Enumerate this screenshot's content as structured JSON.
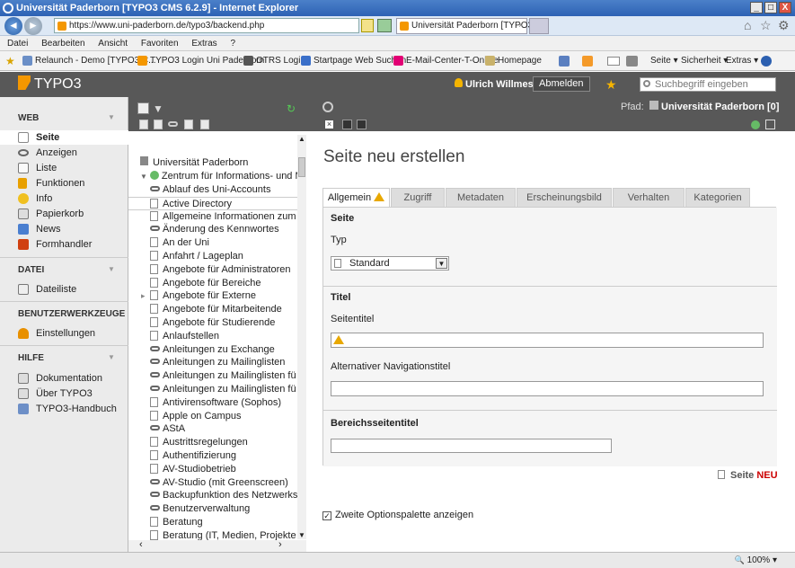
{
  "window": {
    "title": "Universität Paderborn [TYPO3 CMS 6.2.9] - Internet Explorer",
    "min": "_",
    "max": "□",
    "close": "X"
  },
  "browser": {
    "address": "https://www.uni-paderborn.de/typo3/backend.php",
    "tab_active": "Universität Paderborn [TYPO3 ...",
    "tab_close": "×"
  },
  "menu": [
    "Datei",
    "Bearbeiten",
    "Ansicht",
    "Favoriten",
    "Extras",
    "?"
  ],
  "favorites": [
    {
      "label": "Relaunch - Demo [TYPO3 C...",
      "icon": "page-icon",
      "color": "#6b8fc7"
    },
    {
      "label": "TYPO3 Login Uni Paderborn",
      "icon": "typo3-icon",
      "color": "#f49700"
    },
    {
      "label": "OTRS  Login",
      "icon": "otrs-icon",
      "color": "#555555"
    },
    {
      "label": "Startpage Web Suchen",
      "icon": "startpage-icon",
      "color": "#3a6fc9"
    },
    {
      "label": "E-Mail-Center-T-Online",
      "icon": "telekom-icon",
      "color": "#e20074"
    },
    {
      "label": "Homepage",
      "icon": "page-icon",
      "color": "#c9b26b"
    }
  ],
  "ie_commands": [
    "Seite ▾",
    "Sicherheit ▾",
    "Extras ▾"
  ],
  "typo3": {
    "logo": "TYPO3",
    "user": "Ulrich Willmes",
    "logout": "Abmelden",
    "search_placeholder": "Suchbegriff eingeben",
    "path_label": "Pfad:",
    "path_value": "Universität Paderborn [0]"
  },
  "modules": {
    "web": {
      "heading": "WEB",
      "items": [
        "Seite",
        "Anzeigen",
        "Liste",
        "Funktionen",
        "Info",
        "Papierkorb",
        "News",
        "Formhandler"
      ]
    },
    "datei": {
      "heading": "DATEI",
      "items": [
        "Dateiliste"
      ]
    },
    "tools": {
      "heading": "BENUTZERWERKZEUGE",
      "items": [
        "Einstellungen"
      ]
    },
    "hilfe": {
      "heading": "HILFE",
      "items": [
        "Dokumentation",
        "Über TYPO3",
        "TYPO3-Handbuch"
      ]
    }
  },
  "tree": {
    "root": "Universität Paderborn",
    "zim": "Zentrum für Informations- und M",
    "items": [
      {
        "label": "Ablauf des Uni-Accounts",
        "icon": "link"
      },
      {
        "label": "Active Directory",
        "icon": "page"
      },
      {
        "label": "Allgemeine Informationen zum",
        "icon": "page"
      },
      {
        "label": "Änderung des Kennwortes",
        "icon": "link"
      },
      {
        "label": "An der Uni",
        "icon": "page"
      },
      {
        "label": "Anfahrt / Lageplan",
        "icon": "page"
      },
      {
        "label": "Angebote für Administratoren",
        "icon": "page"
      },
      {
        "label": "Angebote für Bereiche",
        "icon": "page"
      },
      {
        "label": "Angebote für Externe",
        "icon": "page"
      },
      {
        "label": "Angebote für Mitarbeitende",
        "icon": "page"
      },
      {
        "label": "Angebote für Studierende",
        "icon": "page"
      },
      {
        "label": "Anlaufstellen",
        "icon": "page"
      },
      {
        "label": "Anleitungen zu Exchange",
        "icon": "link"
      },
      {
        "label": "Anleitungen zu Mailinglisten",
        "icon": "link"
      },
      {
        "label": "Anleitungen zu Mailinglisten fü",
        "icon": "link"
      },
      {
        "label": "Anleitungen zu Mailinglisten fü",
        "icon": "link"
      },
      {
        "label": "Antivirensoftware (Sophos)",
        "icon": "page"
      },
      {
        "label": "Apple on Campus",
        "icon": "page"
      },
      {
        "label": "AStA",
        "icon": "link"
      },
      {
        "label": "Austrittsregelungen",
        "icon": "page"
      },
      {
        "label": "Authentifizierung",
        "icon": "page"
      },
      {
        "label": "AV-Studiobetrieb",
        "icon": "page"
      },
      {
        "label": "AV-Studio (mit Greenscreen)",
        "icon": "link"
      },
      {
        "label": "Backupfunktion des Netzwerks",
        "icon": "link"
      },
      {
        "label": "Benutzerverwaltung",
        "icon": "link"
      },
      {
        "label": "Beratung",
        "icon": "page"
      },
      {
        "label": "Beratung (IT, Medien, Projekte",
        "icon": "page"
      }
    ]
  },
  "content": {
    "title": "Seite neu erstellen",
    "tabs": [
      "Allgemein",
      "Zugriff",
      "Metadaten",
      "Erscheinungsbild",
      "Verhalten",
      "Kategorien"
    ],
    "section_seite": "Seite",
    "typ_label": "Typ",
    "typ_value": "Standard",
    "section_titel": "Titel",
    "seitentitel_label": "Seitentitel",
    "navtitel_label": "Alternativer Navigationstitel",
    "section_bereich": "Bereichsseitentitel",
    "new_page_label": "Seite",
    "new_page_neu": "NEU",
    "checkbox_label": "Zweite Optionspalette anzeigen",
    "checkbox_checked": "✓"
  },
  "status": {
    "zoom": "100%"
  }
}
